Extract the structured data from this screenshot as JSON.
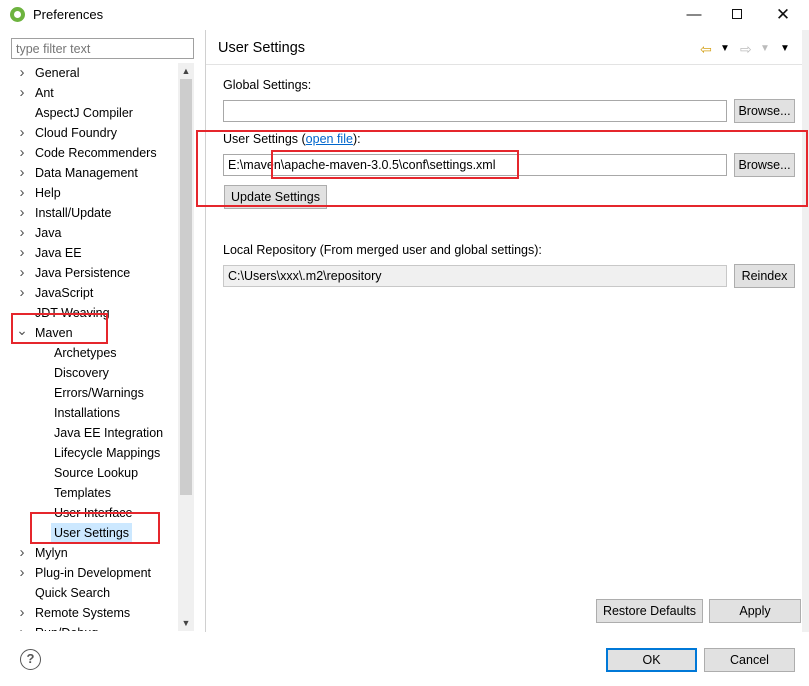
{
  "window": {
    "title": "Preferences",
    "minimize_glyph": "—",
    "close_glyph": "✕"
  },
  "filter": {
    "placeholder": "type filter text"
  },
  "tree": {
    "items": [
      {
        "label": "General",
        "expandable": true
      },
      {
        "label": "Ant",
        "expandable": true
      },
      {
        "label": "AspectJ Compiler",
        "expandable": false
      },
      {
        "label": "Cloud Foundry",
        "expandable": true
      },
      {
        "label": "Code Recommenders",
        "expandable": true
      },
      {
        "label": "Data Management",
        "expandable": true
      },
      {
        "label": "Help",
        "expandable": true
      },
      {
        "label": "Install/Update",
        "expandable": true
      },
      {
        "label": "Java",
        "expandable": true
      },
      {
        "label": "Java EE",
        "expandable": true
      },
      {
        "label": "Java Persistence",
        "expandable": true
      },
      {
        "label": "JavaScript",
        "expandable": true
      },
      {
        "label": "JDT Weaving",
        "expandable": false
      },
      {
        "label": "Maven",
        "expandable": true,
        "expanded": true
      },
      {
        "label": "Mylyn",
        "expandable": true
      },
      {
        "label": "Plug-in Development",
        "expandable": true
      },
      {
        "label": "Quick Search",
        "expandable": false
      },
      {
        "label": "Remote Systems",
        "expandable": true
      },
      {
        "label": "Run/Debug",
        "expandable": true
      }
    ],
    "maven_children": [
      {
        "label": "Archetypes"
      },
      {
        "label": "Discovery"
      },
      {
        "label": "Errors/Warnings"
      },
      {
        "label": "Installations"
      },
      {
        "label": "Java EE Integration"
      },
      {
        "label": "Lifecycle Mappings"
      },
      {
        "label": "Source Lookup"
      },
      {
        "label": "Templates"
      },
      {
        "label": "User Interface"
      },
      {
        "label": "User Settings",
        "selected": true
      }
    ]
  },
  "page": {
    "title": "User Settings",
    "global_settings_label": "Global Settings:",
    "global_settings_value": "",
    "browse_label": "Browse...",
    "user_settings_label_prefix": "User Settings (",
    "open_file_link": "open file",
    "user_settings_label_suffix": "):",
    "user_settings_value": "E:\\maven\\apache-maven-3.0.5\\conf\\settings.xml",
    "update_settings_label": "Update Settings",
    "local_repo_label": "Local Repository (From merged user and global settings):",
    "local_repo_value": "C:\\Users\\xxx\\.m2\\repository",
    "reindex_label": "Reindex",
    "restore_defaults_label": "Restore Defaults",
    "apply_label": "Apply"
  },
  "bottom": {
    "help_glyph": "?",
    "ok_label": "OK",
    "cancel_label": "Cancel"
  },
  "colors": {
    "highlight": "#e5262c",
    "selection": "#cce8ff",
    "link": "#0066cc"
  }
}
